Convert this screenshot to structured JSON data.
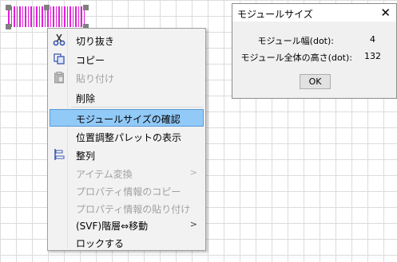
{
  "context_menu": {
    "items": [
      {
        "label": "切り抜き",
        "icon": "scissors-icon",
        "disabled": false
      },
      {
        "label": "コピー",
        "icon": "copy-icon",
        "disabled": false
      },
      {
        "label": "貼り付け",
        "icon": "paste-icon",
        "disabled": true
      },
      {
        "label": "削除",
        "icon": "",
        "disabled": false
      },
      {
        "label": "モジュールサイズの確認",
        "icon": "",
        "disabled": false,
        "highlighted": true
      },
      {
        "label": "位置調整パレットの表示",
        "icon": "",
        "disabled": false
      },
      {
        "label": "整列",
        "icon": "align-icon",
        "disabled": false
      },
      {
        "label": "アイテム変換",
        "icon": "",
        "disabled": true,
        "submenu": true
      },
      {
        "label": "プロパティ情報のコピー",
        "icon": "",
        "disabled": true
      },
      {
        "label": "プロパティ情報の貼り付け",
        "icon": "",
        "disabled": true
      },
      {
        "label": "(SVF)階層⇔移動",
        "icon": "",
        "disabled": false,
        "submenu": true
      },
      {
        "label": "ロックする",
        "icon": "",
        "disabled": false
      }
    ],
    "submenu_arrow": ">"
  },
  "dialog": {
    "title": "モジュールサイズ",
    "close_glyph": "✕",
    "rows": [
      {
        "label": "モジュール幅(dot):",
        "value": "4"
      },
      {
        "label": "モジュール全体の高さ(dot):",
        "value": "132"
      }
    ],
    "ok_label": "OK"
  },
  "colors": {
    "barcode": "#e020d8",
    "highlight": "#91c9f7",
    "menu_bg": "#f2f2f2",
    "dialog_bg": "#f0f0f0"
  }
}
